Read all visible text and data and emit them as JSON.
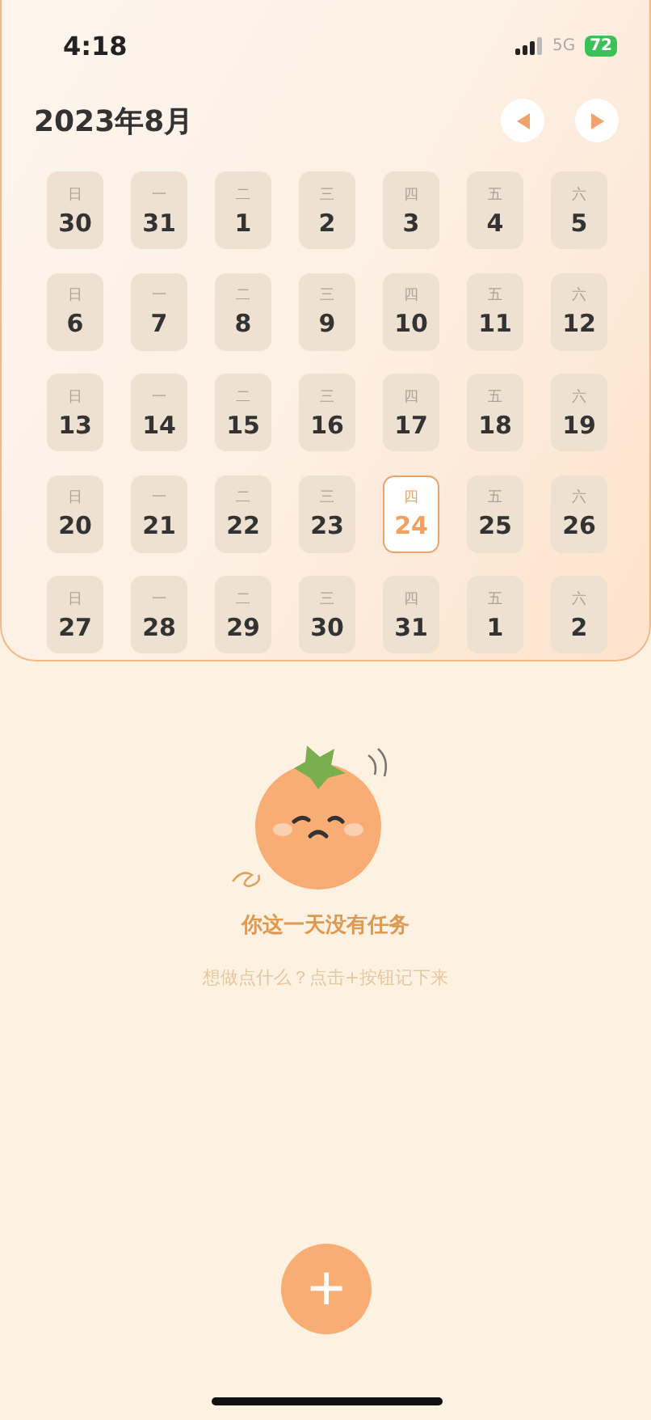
{
  "status_bar": {
    "time": "4:18",
    "network": "5G",
    "battery": "72"
  },
  "header": {
    "title": "2023年8月"
  },
  "weeks": [
    [
      {
        "weekday": "日",
        "date": "30",
        "selected": false
      },
      {
        "weekday": "一",
        "date": "31",
        "selected": false
      },
      {
        "weekday": "二",
        "date": "1",
        "selected": false
      },
      {
        "weekday": "三",
        "date": "2",
        "selected": false
      },
      {
        "weekday": "四",
        "date": "3",
        "selected": false
      },
      {
        "weekday": "五",
        "date": "4",
        "selected": false
      },
      {
        "weekday": "六",
        "date": "5",
        "selected": false
      }
    ],
    [
      {
        "weekday": "日",
        "date": "6",
        "selected": false
      },
      {
        "weekday": "一",
        "date": "7",
        "selected": false
      },
      {
        "weekday": "二",
        "date": "8",
        "selected": false
      },
      {
        "weekday": "三",
        "date": "9",
        "selected": false
      },
      {
        "weekday": "四",
        "date": "10",
        "selected": false
      },
      {
        "weekday": "五",
        "date": "11",
        "selected": false
      },
      {
        "weekday": "六",
        "date": "12",
        "selected": false
      }
    ],
    [
      {
        "weekday": "日",
        "date": "13",
        "selected": false
      },
      {
        "weekday": "一",
        "date": "14",
        "selected": false
      },
      {
        "weekday": "二",
        "date": "15",
        "selected": false
      },
      {
        "weekday": "三",
        "date": "16",
        "selected": false
      },
      {
        "weekday": "四",
        "date": "17",
        "selected": false
      },
      {
        "weekday": "五",
        "date": "18",
        "selected": false
      },
      {
        "weekday": "六",
        "date": "19",
        "selected": false
      }
    ],
    [
      {
        "weekday": "日",
        "date": "20",
        "selected": false
      },
      {
        "weekday": "一",
        "date": "21",
        "selected": false
      },
      {
        "weekday": "二",
        "date": "22",
        "selected": false
      },
      {
        "weekday": "三",
        "date": "23",
        "selected": false
      },
      {
        "weekday": "四",
        "date": "24",
        "selected": true
      },
      {
        "weekday": "五",
        "date": "25",
        "selected": false
      },
      {
        "weekday": "六",
        "date": "26",
        "selected": false
      }
    ],
    [
      {
        "weekday": "日",
        "date": "27",
        "selected": false
      },
      {
        "weekday": "一",
        "date": "28",
        "selected": false
      },
      {
        "weekday": "二",
        "date": "29",
        "selected": false
      },
      {
        "weekday": "三",
        "date": "30",
        "selected": false
      },
      {
        "weekday": "四",
        "date": "31",
        "selected": false
      },
      {
        "weekday": "五",
        "date": "1",
        "selected": false
      },
      {
        "weekday": "六",
        "date": "2",
        "selected": false
      }
    ]
  ],
  "empty_state": {
    "title": "你这一天没有任务",
    "hint": "想做点什么？点击+按钮记下来"
  },
  "add_button": {
    "label": "+"
  }
}
